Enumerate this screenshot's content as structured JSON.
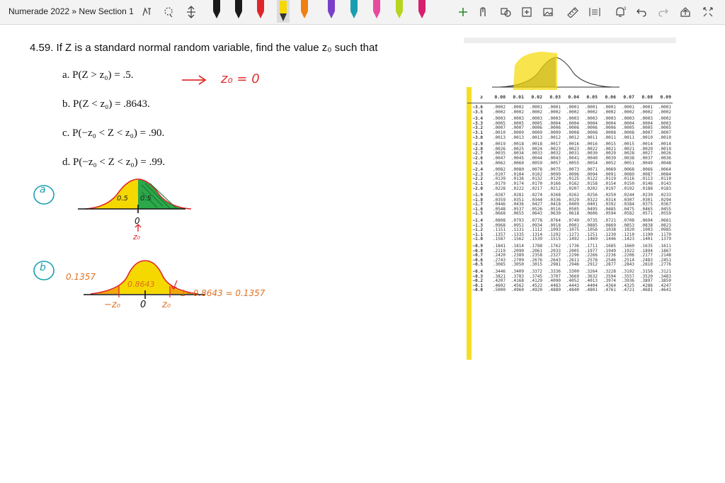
{
  "app": {
    "title": "Numerade 2022 » New Section 1"
  },
  "toolbar": {
    "tools": [
      "lasso-tool",
      "add-space-tool",
      "pen-black",
      "pen-black-2",
      "pen-red",
      "pen-orange",
      "pen-yellow",
      "pen-purple",
      "pen-teal",
      "pen-pink",
      "pen-yellow-green",
      "pen-magenta",
      "add-pen-button",
      "ink-to-shape-button",
      "ink-to-text-button",
      "math-button",
      "ruler-button",
      "replay-button",
      "undo-button",
      "redo-button",
      "share-button",
      "fullscreen-button"
    ],
    "colors": {
      "black": "#1a1a1a",
      "red": "#e0262b",
      "orange": "#f08010",
      "yellow": "#f5d800",
      "purple": "#7a3fc9",
      "teal": "#1a9fb0",
      "pink": "#e84aa0",
      "yellow_green": "#b8d420",
      "magenta": "#d6206b"
    }
  },
  "problem": {
    "heading": "4.59. If Z is a standard normal random variable, find the value z₀ such that",
    "items": [
      {
        "label": "a.",
        "expr": "P(Z > z₀) = .5."
      },
      {
        "label": "b.",
        "expr": "P(Z < z₀) = .8643."
      },
      {
        "label": "c.",
        "expr": "P(−z₀ < Z < z₀) = .90."
      },
      {
        "label": "d.",
        "expr": "P(−z₀ < Z < z₀) = .99."
      }
    ]
  },
  "handwriting": {
    "answer_a": "z₀ = 0",
    "circle_a": "a",
    "circle_b": "b",
    "curve_a_left": "0.5",
    "curve_a_right": "0.5",
    "curve_a_zero": "0",
    "curve_a_z0": "z₀",
    "curve_b_left": "0.1357",
    "curve_b_center": "0.8643",
    "curve_b_formula": "1−0.8643 = 0.1357",
    "curve_b_neg": "−z₀",
    "curve_b_zero": "0",
    "curve_b_pos": "z₀"
  },
  "ztable": {
    "headers": [
      "z",
      "0.00",
      "0.01",
      "0.02",
      "0.03",
      "0.04",
      "0.05",
      "0.06",
      "0.07",
      "0.08",
      "0.09"
    ],
    "groups": [
      [
        [
          "−3.6",
          ".0002",
          ".0002",
          ".0001",
          ".0001",
          ".0001",
          ".0001",
          ".0001",
          ".0001",
          ".0001",
          ".0001"
        ],
        [
          "−3.5",
          ".0002",
          ".0002",
          ".0002",
          ".0002",
          ".0002",
          ".0002",
          ".0002",
          ".0002",
          ".0002",
          ".0002"
        ]
      ],
      [
        [
          "−3.4",
          ".0003",
          ".0003",
          ".0003",
          ".0003",
          ".0003",
          ".0003",
          ".0003",
          ".0003",
          ".0003",
          ".0002"
        ],
        [
          "−3.3",
          ".0005",
          ".0005",
          ".0005",
          ".0004",
          ".0004",
          ".0004",
          ".0004",
          ".0004",
          ".0004",
          ".0003"
        ],
        [
          "−3.2",
          ".0007",
          ".0007",
          ".0006",
          ".0006",
          ".0006",
          ".0006",
          ".0006",
          ".0005",
          ".0005",
          ".0005"
        ],
        [
          "−3.1",
          ".0010",
          ".0009",
          ".0009",
          ".0009",
          ".0008",
          ".0008",
          ".0008",
          ".0008",
          ".0007",
          ".0007"
        ],
        [
          "−3.0",
          ".0013",
          ".0013",
          ".0013",
          ".0012",
          ".0012",
          ".0011",
          ".0011",
          ".0011",
          ".0010",
          ".0010"
        ]
      ],
      [
        [
          "−2.9",
          ".0019",
          ".0018",
          ".0018",
          ".0017",
          ".0016",
          ".0016",
          ".0015",
          ".0015",
          ".0014",
          ".0014"
        ],
        [
          "−2.8",
          ".0026",
          ".0025",
          ".0024",
          ".0023",
          ".0023",
          ".0022",
          ".0021",
          ".0021",
          ".0020",
          ".0019"
        ],
        [
          "−2.7",
          ".0035",
          ".0034",
          ".0033",
          ".0032",
          ".0031",
          ".0030",
          ".0029",
          ".0028",
          ".0027",
          ".0026"
        ],
        [
          "−2.6",
          ".0047",
          ".0045",
          ".0044",
          ".0043",
          ".0041",
          ".0040",
          ".0039",
          ".0038",
          ".0037",
          ".0036"
        ],
        [
          "−2.5",
          ".0062",
          ".0060",
          ".0059",
          ".0057",
          ".0055",
          ".0054",
          ".0052",
          ".0051",
          ".0049",
          ".0048"
        ]
      ],
      [
        [
          "−2.4",
          ".0082",
          ".0080",
          ".0078",
          ".0075",
          ".0073",
          ".0071",
          ".0069",
          ".0068",
          ".0066",
          ".0064"
        ],
        [
          "−2.3",
          ".0107",
          ".0104",
          ".0102",
          ".0099",
          ".0096",
          ".0094",
          ".0091",
          ".0089",
          ".0087",
          ".0084"
        ],
        [
          "−2.2",
          ".0139",
          ".0136",
          ".0132",
          ".0129",
          ".0125",
          ".0122",
          ".0119",
          ".0116",
          ".0113",
          ".0110"
        ],
        [
          "−2.1",
          ".0179",
          ".0174",
          ".0170",
          ".0166",
          ".0162",
          ".0158",
          ".0154",
          ".0150",
          ".0146",
          ".0143"
        ],
        [
          "−2.0",
          ".0228",
          ".0222",
          ".0217",
          ".0212",
          ".0207",
          ".0202",
          ".0197",
          ".0192",
          ".0188",
          ".0183"
        ]
      ],
      [
        [
          "−1.9",
          ".0287",
          ".0281",
          ".0274",
          ".0268",
          ".0262",
          ".0256",
          ".0250",
          ".0244",
          ".0239",
          ".0233"
        ],
        [
          "−1.8",
          ".0359",
          ".0351",
          ".0344",
          ".0336",
          ".0329",
          ".0322",
          ".0314",
          ".0307",
          ".0301",
          ".0294"
        ],
        [
          "−1.7",
          ".0446",
          ".0436",
          ".0427",
          ".0418",
          ".0409",
          ".0401",
          ".0392",
          ".0384",
          ".0375",
          ".0367"
        ],
        [
          "−1.6",
          ".0548",
          ".0537",
          ".0526",
          ".0516",
          ".0505",
          ".0495",
          ".0485",
          ".0475",
          ".0465",
          ".0455"
        ],
        [
          "−1.5",
          ".0668",
          ".0655",
          ".0643",
          ".0630",
          ".0618",
          ".0606",
          ".0594",
          ".0582",
          ".0571",
          ".0559"
        ]
      ],
      [
        [
          "−1.4",
          ".0808",
          ".0793",
          ".0778",
          ".0764",
          ".0749",
          ".0735",
          ".0721",
          ".0708",
          ".0694",
          ".0681"
        ],
        [
          "−1.3",
          ".0968",
          ".0951",
          ".0934",
          ".0918",
          ".0901",
          ".0885",
          ".0869",
          ".0853",
          ".0838",
          ".0823"
        ],
        [
          "−1.2",
          ".1151",
          ".1131",
          ".1112",
          ".1093",
          ".1075",
          ".1056",
          ".1038",
          ".1020",
          ".1003",
          ".0985"
        ],
        [
          "−1.1",
          ".1357",
          ".1335",
          ".1314",
          ".1292",
          ".1271",
          ".1251",
          ".1230",
          ".1210",
          ".1190",
          ".1170"
        ],
        [
          "−1.0",
          ".1587",
          ".1562",
          ".1539",
          ".1515",
          ".1492",
          ".1469",
          ".1446",
          ".1423",
          ".1401",
          ".1379"
        ]
      ],
      [
        [
          "−0.9",
          ".1841",
          ".1814",
          ".1788",
          ".1762",
          ".1736",
          ".1711",
          ".1685",
          ".1660",
          ".1635",
          ".1611"
        ],
        [
          "−0.8",
          ".2119",
          ".2090",
          ".2061",
          ".2033",
          ".2005",
          ".1977",
          ".1949",
          ".1922",
          ".1894",
          ".1867"
        ],
        [
          "−0.7",
          ".2420",
          ".2389",
          ".2358",
          ".2327",
          ".2296",
          ".2266",
          ".2236",
          ".2206",
          ".2177",
          ".2148"
        ],
        [
          "−0.6",
          ".2743",
          ".2709",
          ".2676",
          ".2643",
          ".2611",
          ".2578",
          ".2546",
          ".2514",
          ".2483",
          ".2451"
        ],
        [
          "−0.5",
          ".3085",
          ".3050",
          ".3015",
          ".2981",
          ".2946",
          ".2912",
          ".2877",
          ".2843",
          ".2810",
          ".2776"
        ]
      ],
      [
        [
          "−0.4",
          ".3446",
          ".3409",
          ".3372",
          ".3336",
          ".3300",
          ".3264",
          ".3228",
          ".3192",
          ".3156",
          ".3121"
        ],
        [
          "−0.3",
          ".3821",
          ".3783",
          ".3745",
          ".3707",
          ".3669",
          ".3632",
          ".3594",
          ".3557",
          ".3520",
          ".3483"
        ],
        [
          "−0.2",
          ".4207",
          ".4168",
          ".4129",
          ".4090",
          ".4052",
          ".4013",
          ".3974",
          ".3936",
          ".3897",
          ".3859"
        ],
        [
          "−0.1",
          ".4602",
          ".4562",
          ".4522",
          ".4483",
          ".4443",
          ".4404",
          ".4364",
          ".4325",
          ".4286",
          ".4247"
        ],
        [
          "−0.0",
          ".5000",
          ".4960",
          ".4920",
          ".4880",
          ".4840",
          ".4801",
          ".4761",
          ".4721",
          ".4681",
          ".4641"
        ]
      ]
    ]
  }
}
